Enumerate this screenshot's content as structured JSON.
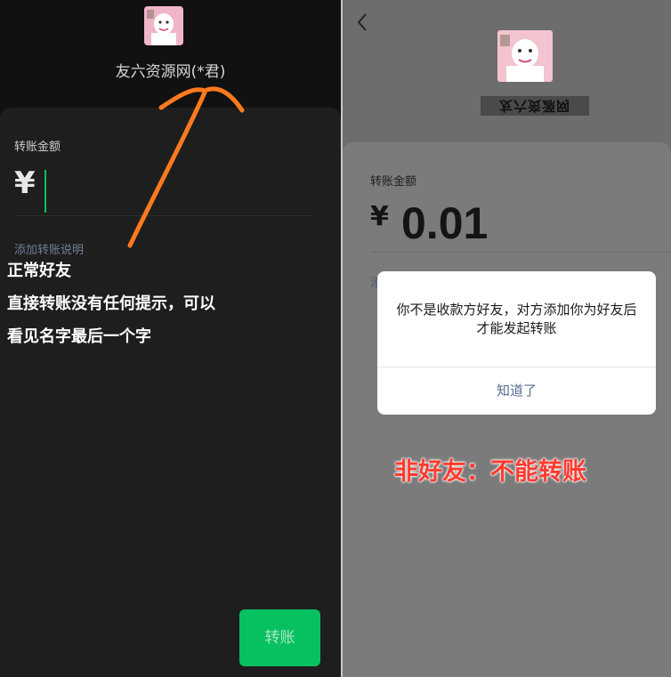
{
  "left_screen": {
    "payee_name": "友六资源网(*君)",
    "amount_label": "转账金额",
    "currency_symbol": "¥",
    "add_note_link": "添加转账说明",
    "annotation": {
      "line1": "正常好友",
      "line2": "直接转账没有任何提示，可以",
      "line3": "看见名字最后一个字"
    },
    "transfer_button": "转账",
    "colors": {
      "accent_green": "#07c160",
      "annotation_arrow": "#ff7a1f"
    }
  },
  "right_screen": {
    "back_icon": "chevron-left-icon",
    "payee_name_mirrored": "友六资源网",
    "amount_label": "转账金额",
    "currency_symbol": "¥",
    "amount_value": "0.01",
    "add_note_link_partial": "添",
    "dialog": {
      "message": "你不是收款方好友，对方添加你为好友后才能发起转账",
      "button": "知道了"
    },
    "annotation": "非好友：不能转账",
    "colors": {
      "warning_red": "#ff3b2f",
      "dialog_link": "#576b95"
    }
  }
}
